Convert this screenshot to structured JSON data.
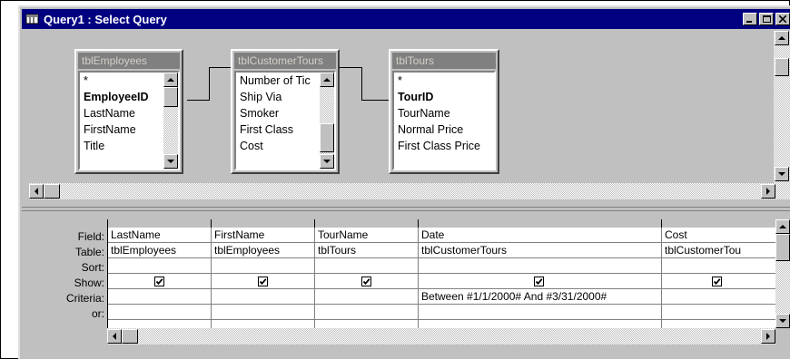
{
  "window": {
    "title": "Query1 : Select Query",
    "controls": [
      "minimize-icon",
      "maximize-icon",
      "close-icon"
    ]
  },
  "tables": [
    {
      "name": "tblEmployees",
      "fields": [
        "*",
        "EmployeeID",
        "LastName",
        "FirstName",
        "Title"
      ],
      "key_field": "EmployeeID"
    },
    {
      "name": "tblCustomerTours",
      "fields": [
        "Number of Tic",
        "Ship Via",
        "Smoker",
        "First Class",
        "Cost"
      ],
      "key_field": ""
    },
    {
      "name": "tblTours",
      "fields": [
        "*",
        "TourID",
        "TourName",
        "Normal Price",
        "First Class Price"
      ],
      "key_field": "TourID"
    }
  ],
  "grid": {
    "row_labels": [
      "Field:",
      "Table:",
      "Sort:",
      "Show:",
      "Criteria:",
      "or:"
    ],
    "columns": [
      {
        "field": "LastName",
        "table": "tblEmployees",
        "sort": "",
        "show": true,
        "criteria": "",
        "or": ""
      },
      {
        "field": "FirstName",
        "table": "tblEmployees",
        "sort": "",
        "show": true,
        "criteria": "",
        "or": ""
      },
      {
        "field": "TourName",
        "table": "tblTours",
        "sort": "",
        "show": true,
        "criteria": "",
        "or": ""
      },
      {
        "field": "Date",
        "table": "tblCustomerTours",
        "sort": "",
        "show": true,
        "criteria": "Between #1/1/2000# And #3/31/2000#",
        "or": ""
      },
      {
        "field": "Cost",
        "table": "tblCustomerTou",
        "sort": "",
        "show": true,
        "criteria": "",
        "or": ""
      }
    ]
  },
  "colors": {
    "title_bar": "#000080",
    "face": "#c0c0c0",
    "table_title": "#808080"
  }
}
